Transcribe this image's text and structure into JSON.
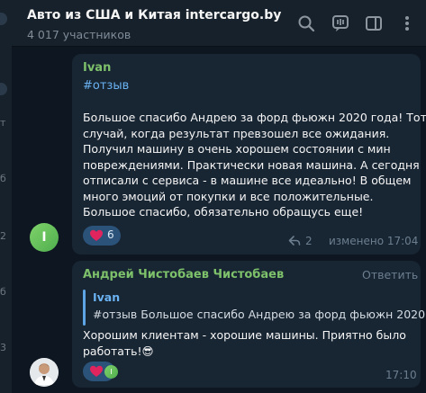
{
  "sidebar_fragments": [
    "т",
    "б",
    "2",
    "б",
    "3"
  ],
  "header": {
    "title": "Авто из США и Китая intercargo.by",
    "subtitle": "4 017 участников"
  },
  "messages": [
    {
      "sender": "Ivan",
      "avatar_letter": "I",
      "hashtag": "#отзыв",
      "lines": [
        "Большое спасибо Андрею за форд фьюжн 2020 года! Тот",
        "случай, когда результат превзошел все ожидания.",
        "Получил машину в очень хорошем состоянии с мин",
        "повреждениями. Практически новая машина. А сегодня",
        "отписали с сервиса - в машине все идеально! В общем",
        "много эмоций от покупки и все положительные.",
        "Большое спасибо, обязательно обращусь еще!"
      ],
      "reaction_count": "6",
      "replies_count": "2",
      "edited_time": "изменено 17:04"
    },
    {
      "sender": "Андрей Чистобаев Чистобаев",
      "reply_label": "Ответить",
      "quote_name": "Ivan",
      "quote_text": "#отзыв  Большое спасибо Андрею за форд фьюжн 2020...",
      "lines": [
        "Хорошим клиентам - хорошие машины. Приятно было",
        "работать!😎"
      ],
      "reaction_avatar_letter": "I",
      "time": "17:10"
    }
  ],
  "colors": {
    "background": "#0e1621",
    "header": "#17212b",
    "bubble": "#182533",
    "accent_green": "#7ec16b",
    "link_blue": "#6ab2f2",
    "reaction": "#2b5278",
    "heart": "#e0245e"
  },
  "icons": [
    "search-icon",
    "voice-chat-icon",
    "sidebar-toggle-icon",
    "more-icon",
    "heart-icon",
    "reply-arrow-icon"
  ]
}
